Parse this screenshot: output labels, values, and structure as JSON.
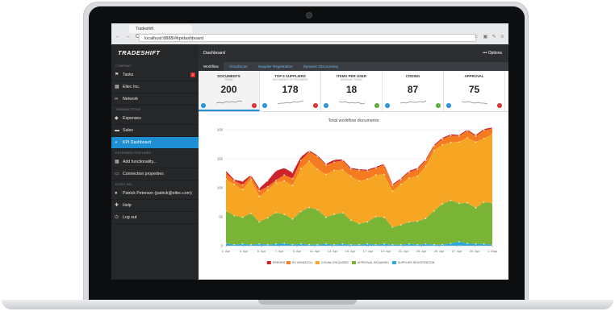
{
  "browser": {
    "tab_title": "Tradeshift",
    "url": "localhost:8888/#kpidashboard",
    "nav_glyphs": "← → C",
    "right_glyphs": "☆ ▣ ✎ ≡"
  },
  "sidebar": {
    "logo": "TRADESHIFT",
    "sections": {
      "company": "COMPANY",
      "transactions": "TRANSACTIONS",
      "extended": "EXTENDED FEATURES",
      "user": "ELTEC INC."
    },
    "items": [
      {
        "label": "Tasks",
        "icon": "flag-icon",
        "glyph": "⚑",
        "badge": "2"
      },
      {
        "label": "Eltec Inc.",
        "icon": "building-icon",
        "glyph": "▦"
      },
      {
        "label": "Network",
        "icon": "link-icon",
        "glyph": "∞"
      },
      {
        "label": "Expenses",
        "icon": "tag-icon",
        "glyph": "◆"
      },
      {
        "label": "Sales",
        "icon": "card-icon",
        "glyph": "▬"
      },
      {
        "label": "KPI Dashboard",
        "icon": "dashboard-icon",
        "glyph": "◕"
      },
      {
        "label": "Add functionality...",
        "icon": "grid-icon",
        "glyph": "▦"
      },
      {
        "label": "Connection properties",
        "icon": "window-icon",
        "glyph": "▭"
      },
      {
        "label": "Patrick Peterson (patrick@eltec.com)",
        "icon": "user-icon",
        "glyph": "●"
      },
      {
        "label": "Help",
        "icon": "lifebuoy-icon",
        "glyph": "✚"
      },
      {
        "label": "Log out",
        "icon": "power-icon",
        "glyph": "⏻"
      }
    ]
  },
  "header": {
    "title": "Dashboard",
    "options_label": "Options",
    "options_glyph": "•••"
  },
  "subtabs": [
    "Workflow",
    "CloudScan",
    "Supplier Registration",
    "Dynamic Discounting"
  ],
  "kpis": [
    {
      "title": "DOCUMENTS",
      "subtitle": "TODAY",
      "value": "200",
      "trend": "up",
      "color": "#d9302b"
    },
    {
      "title": "TOP 5 SUPPLIERS",
      "subtitle": "DOCUMENTS IN PROGRESS",
      "value": "178",
      "trend": "up",
      "color": "#d9302b"
    },
    {
      "title": "ITEMS PER USER",
      "subtitle": "AVERAGE TODAY",
      "value": "18",
      "trend": "down",
      "color": "#5aa83a"
    },
    {
      "title": "CODING",
      "subtitle": "",
      "value": "87",
      "trend": "up",
      "color": "#5aa83a"
    },
    {
      "title": "APPROVAL",
      "subtitle": "",
      "value": "75",
      "trend": "down",
      "color": "#d9302b"
    }
  ],
  "chart_data": {
    "type": "area",
    "title": "Total workflow documents",
    "x": [
      "1. Apr",
      "3. Apr",
      "5. Apr",
      "7. Apr",
      "9. Apr",
      "11. Apr",
      "13. Apr",
      "15. Apr",
      "17. Apr",
      "19. Apr",
      "21. Apr",
      "23. Apr",
      "25. Apr",
      "27. Apr",
      "29. Apr",
      "1. May"
    ],
    "xlabel": "",
    "ylabel": "",
    "ylim": [
      0,
      200
    ],
    "yticks": [
      0,
      50,
      100,
      150,
      200
    ],
    "grid": true,
    "legend_position": "bottom",
    "series": [
      {
        "name": "SUPPLIER REGISTRATION",
        "color": "#2aa7df",
        "values": [
          4,
          2,
          3,
          2,
          3,
          2,
          3,
          4,
          2,
          3,
          2,
          2,
          3,
          2,
          3,
          2,
          2,
          3,
          2,
          3,
          2,
          2,
          3,
          2,
          3,
          2,
          2,
          4,
          7,
          4,
          3,
          3,
          2
        ]
      },
      {
        "name": "APPROVAL REQUIRED",
        "color": "#7ab437",
        "values": [
          56,
          50,
          46,
          54,
          38,
          46,
          54,
          50,
          44,
          56,
          64,
          60,
          46,
          52,
          54,
          42,
          36,
          38,
          48,
          46,
          30,
          34,
          38,
          40,
          44,
          58,
          70,
          74,
          66,
          70,
          62,
          72,
          72
        ]
      },
      {
        "name": "CODING REQUIRED",
        "color": "#f6a623",
        "values": [
          55,
          54,
          48,
          58,
          44,
          48,
          52,
          58,
          58,
          74,
          80,
          70,
          74,
          76,
          74,
          76,
          74,
          74,
          72,
          74,
          62,
          70,
          76,
          78,
          90,
          104,
          102,
          100,
          106,
          112,
          114,
          110,
          118
        ]
      },
      {
        "name": "PO MISMATCH",
        "color": "#f47b20",
        "values": [
          10,
          6,
          8,
          6,
          10,
          6,
          4,
          10,
          12,
          14,
          16,
          22,
          16,
          14,
          16,
          12,
          18,
          14,
          12,
          16,
          10,
          8,
          10,
          12,
          10,
          8,
          10,
          12,
          10,
          12,
          10,
          14,
          10
        ]
      },
      {
        "name": "ERRORS",
        "color": "#cc2229",
        "values": [
          4,
          2,
          6,
          2,
          4,
          10,
          16,
          12,
          10,
          6,
          2,
          2,
          2,
          4,
          2,
          2,
          2,
          2,
          2,
          2,
          2,
          2,
          2,
          2,
          2,
          2,
          2,
          2,
          2,
          2,
          2,
          2,
          2
        ]
      }
    ]
  }
}
